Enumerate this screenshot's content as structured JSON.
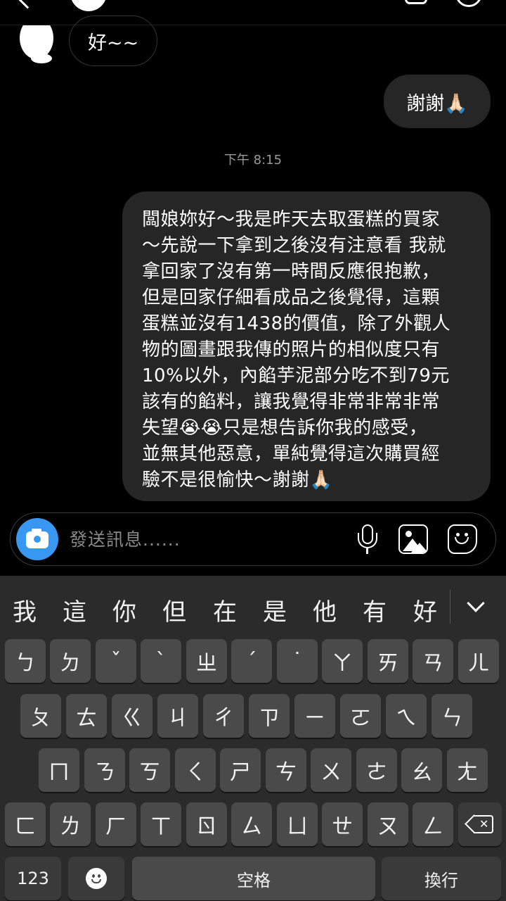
{
  "chat": {
    "received_message": "好~~",
    "sent_thanks": "謝謝🙏🏻",
    "timestamp": "下午 8:15",
    "long_message_lines": [
      "闆娘妳好～我是昨天去取蛋糕的買家",
      "～先說一下拿到之後沒有注意看 我就",
      "拿回家了沒有第一時間反應很抱歉，",
      "但是回家仔細看成品之後覺得，這顆",
      "蛋糕並沒有1438的價值，除了外觀人",
      "物的圖畫跟我傳的照片的相似度只有",
      "10%以外，內餡芋泥部分吃不到79元",
      "該有的餡料，讓我覺得非常非常非常",
      "失望😭😭只是想告訴你我的感受，",
      "並無其他惡意，單純覺得這次購買經",
      "驗不是很愉快～謝謝🙏🏻"
    ]
  },
  "composer": {
    "placeholder": "發送訊息......",
    "icons": [
      "camera-icon",
      "microphone-icon",
      "gallery-icon",
      "sticker-icon"
    ],
    "accent_color": "#3897f0"
  },
  "keyboard": {
    "candidates": [
      "我",
      "這",
      "你",
      "但",
      "在",
      "是",
      "他",
      "有",
      "好"
    ],
    "row1": [
      "ㄅ",
      "ㄉ",
      "ˇ",
      "ˋ",
      "ㄓ",
      "ˊ",
      "˙",
      "ㄚ",
      "ㄞ",
      "ㄢ",
      "ㄦ"
    ],
    "row2": [
      "ㄆ",
      "ㄊ",
      "ㄍ",
      "ㄐ",
      "ㄔ",
      "ㄗ",
      "ㄧ",
      "ㄛ",
      "ㄟ",
      "ㄣ"
    ],
    "row3": [
      "ㄇ",
      "ㄋ",
      "ㄎ",
      "ㄑ",
      "ㄕ",
      "ㄘ",
      "ㄨ",
      "ㄜ",
      "ㄠ",
      "ㄤ"
    ],
    "row4": [
      "ㄈ",
      "ㄌ",
      "ㄏ",
      "ㄒ",
      "ㄖ",
      "ㄙ",
      "ㄩ",
      "ㄝ",
      "ㄡ",
      "ㄥ"
    ],
    "numbers_label": "123",
    "space_label": "空格",
    "return_label": "換行"
  }
}
